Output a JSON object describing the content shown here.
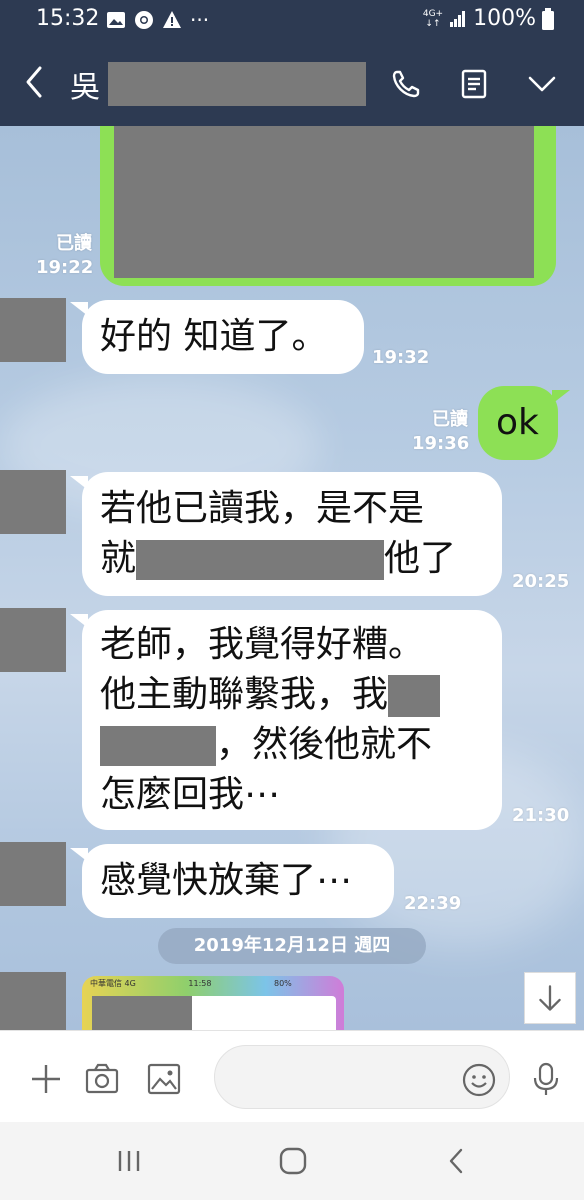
{
  "status_bar": {
    "time": "15:32",
    "network": "4G+",
    "battery": "100%",
    "more": "···"
  },
  "header": {
    "contact_name": "吳"
  },
  "messages": [
    {
      "id": "m0",
      "side": "right",
      "type": "image",
      "read_label": "已讀",
      "time": "19:22"
    },
    {
      "id": "m1",
      "side": "left",
      "text": "好的 知道了。",
      "time": "19:32"
    },
    {
      "id": "m2",
      "side": "right",
      "text": "ok",
      "read_label": "已讀",
      "time": "19:36"
    },
    {
      "id": "m3",
      "side": "left",
      "lines": [
        "若他已讀我，是不是",
        "就",
        "他了"
      ],
      "time": "20:25"
    },
    {
      "id": "m4",
      "side": "left",
      "lines": [
        "老師，我覺得好糟。",
        "他主動聯繫我，我",
        "，然後他就不",
        "怎麼回我⋯"
      ],
      "time": "21:30"
    },
    {
      "id": "m5",
      "side": "left",
      "text": "感覺快放棄了⋯",
      "time": "22:39"
    }
  ],
  "date_separator": "2019年12月12日 週四",
  "thumbnail": {
    "carrier": "中華電信 4G",
    "time": "11:58",
    "battery": "80%"
  },
  "input": {
    "placeholder": ""
  },
  "icons": {
    "back": "chevron-left-icon",
    "call": "phone-icon",
    "notes": "note-icon",
    "menu": "chevron-down-icon",
    "add": "plus-icon",
    "camera": "camera-icon",
    "gallery": "image-icon",
    "emoji": "emoji-icon",
    "mic": "microphone-icon",
    "scroll_down": "arrow-down-icon"
  },
  "colors": {
    "header_bg": "#2d3a52",
    "sent_bubble": "#8de055",
    "received_bubble": "#ffffff",
    "redaction": "#7a7a7a"
  }
}
